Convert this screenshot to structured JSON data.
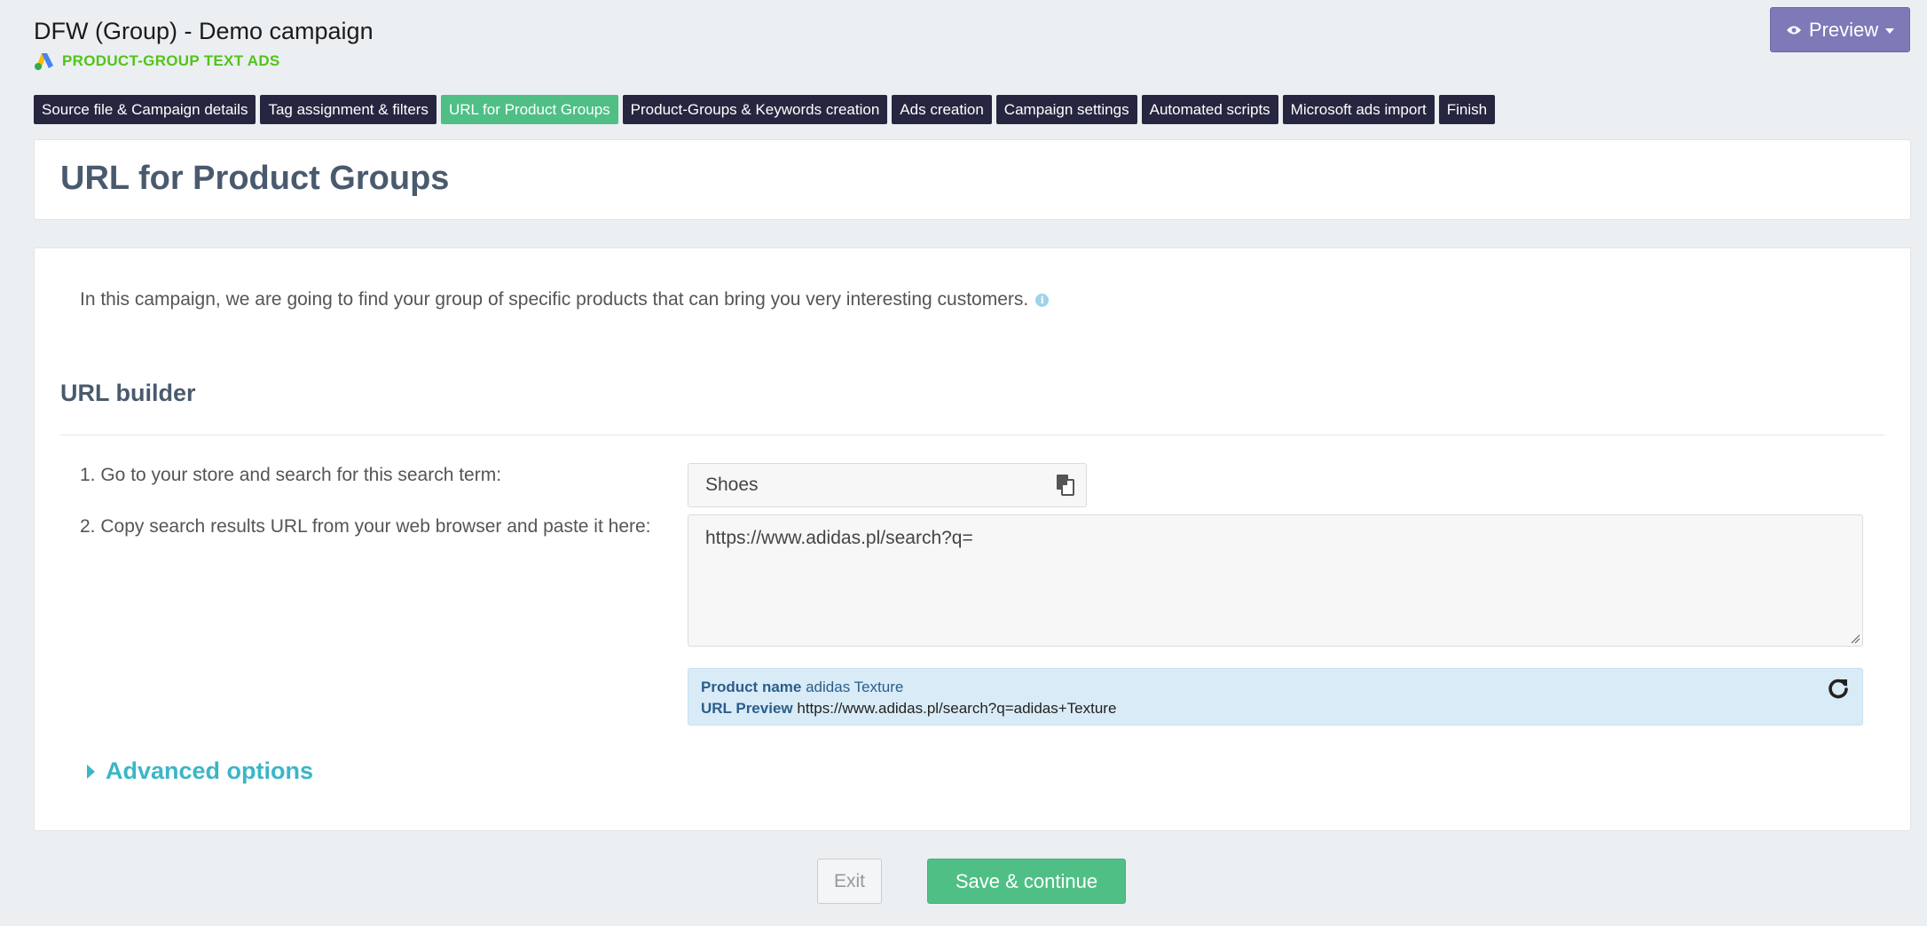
{
  "header": {
    "campaign_title": "DFW (Group) - Demo campaign",
    "campaign_type": "PRODUCT-GROUP TEXT ADS",
    "preview_label": "Preview"
  },
  "steps": [
    {
      "label": "Source file & Campaign details",
      "active": false
    },
    {
      "label": "Tag assignment & filters",
      "active": false
    },
    {
      "label": "URL for Product Groups",
      "active": true
    },
    {
      "label": "Product-Groups & Keywords creation",
      "active": false
    },
    {
      "label": "Ads creation",
      "active": false
    },
    {
      "label": "Campaign settings",
      "active": false
    },
    {
      "label": "Automated scripts",
      "active": false
    },
    {
      "label": "Microsoft ads import",
      "active": false
    },
    {
      "label": "Finish",
      "active": false
    }
  ],
  "page_title": "URL for Product Groups",
  "intro_text": "In this campaign, we are going to find your group of specific products that can bring you very interesting customers.",
  "url_builder": {
    "title": "URL builder",
    "step1_label": "1. Go to your store and search for this search term:",
    "search_term": "Shoes",
    "step2_label": "2. Copy search results URL from your web browser and paste it here:",
    "url_value": "https://www.adidas.pl/search?q=",
    "preview": {
      "product_name_label": "Product name",
      "product_name_value": "adidas Texture",
      "url_preview_label": "URL Preview",
      "url_preview_value": "https://www.adidas.pl/search?q=adidas+Texture"
    }
  },
  "advanced_options_label": "Advanced options",
  "footer": {
    "exit_label": "Exit",
    "save_label": "Save & continue"
  },
  "colors": {
    "step_tab": "#272640",
    "step_tab_active": "#4fbf85",
    "preview_button": "#7e7ab8",
    "campaign_type": "#52c41a",
    "advanced_link": "#3bb6c6",
    "save_button": "#4fbf85"
  },
  "icons": [
    "google-ads-icon",
    "eye-icon",
    "caret-down-icon",
    "info-icon",
    "copy-icon",
    "refresh-icon",
    "caret-right-icon"
  ]
}
